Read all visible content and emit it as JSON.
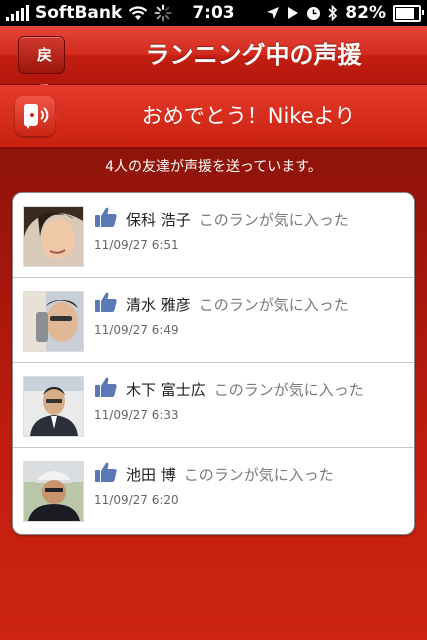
{
  "status_bar": {
    "carrier": "SoftBank",
    "time": "7:03",
    "battery": "82%",
    "battery_level": 0.82
  },
  "nav": {
    "back_label": "戻る",
    "title": "ランニング中の声援"
  },
  "cheer": {
    "title": "おめでとう！Nikeより"
  },
  "summary": "4人の友達が声援を送っています。",
  "friends": [
    {
      "name": "保科 浩子",
      "action": "このランが気に入った",
      "time": "11/09/27  6:51"
    },
    {
      "name": "清水 雅彦",
      "action": "このランが気に入った",
      "time": "11/09/27  6:49"
    },
    {
      "name": "木下 富士広",
      "action": "このランが気に入った",
      "time": "11/09/27  6:33"
    },
    {
      "name": "池田 博",
      "action": "このランが気に入った",
      "time": "11/09/27  6:20"
    }
  ],
  "colors": {
    "brand_red": "#c41e12",
    "like_blue": "#5b79b6"
  }
}
